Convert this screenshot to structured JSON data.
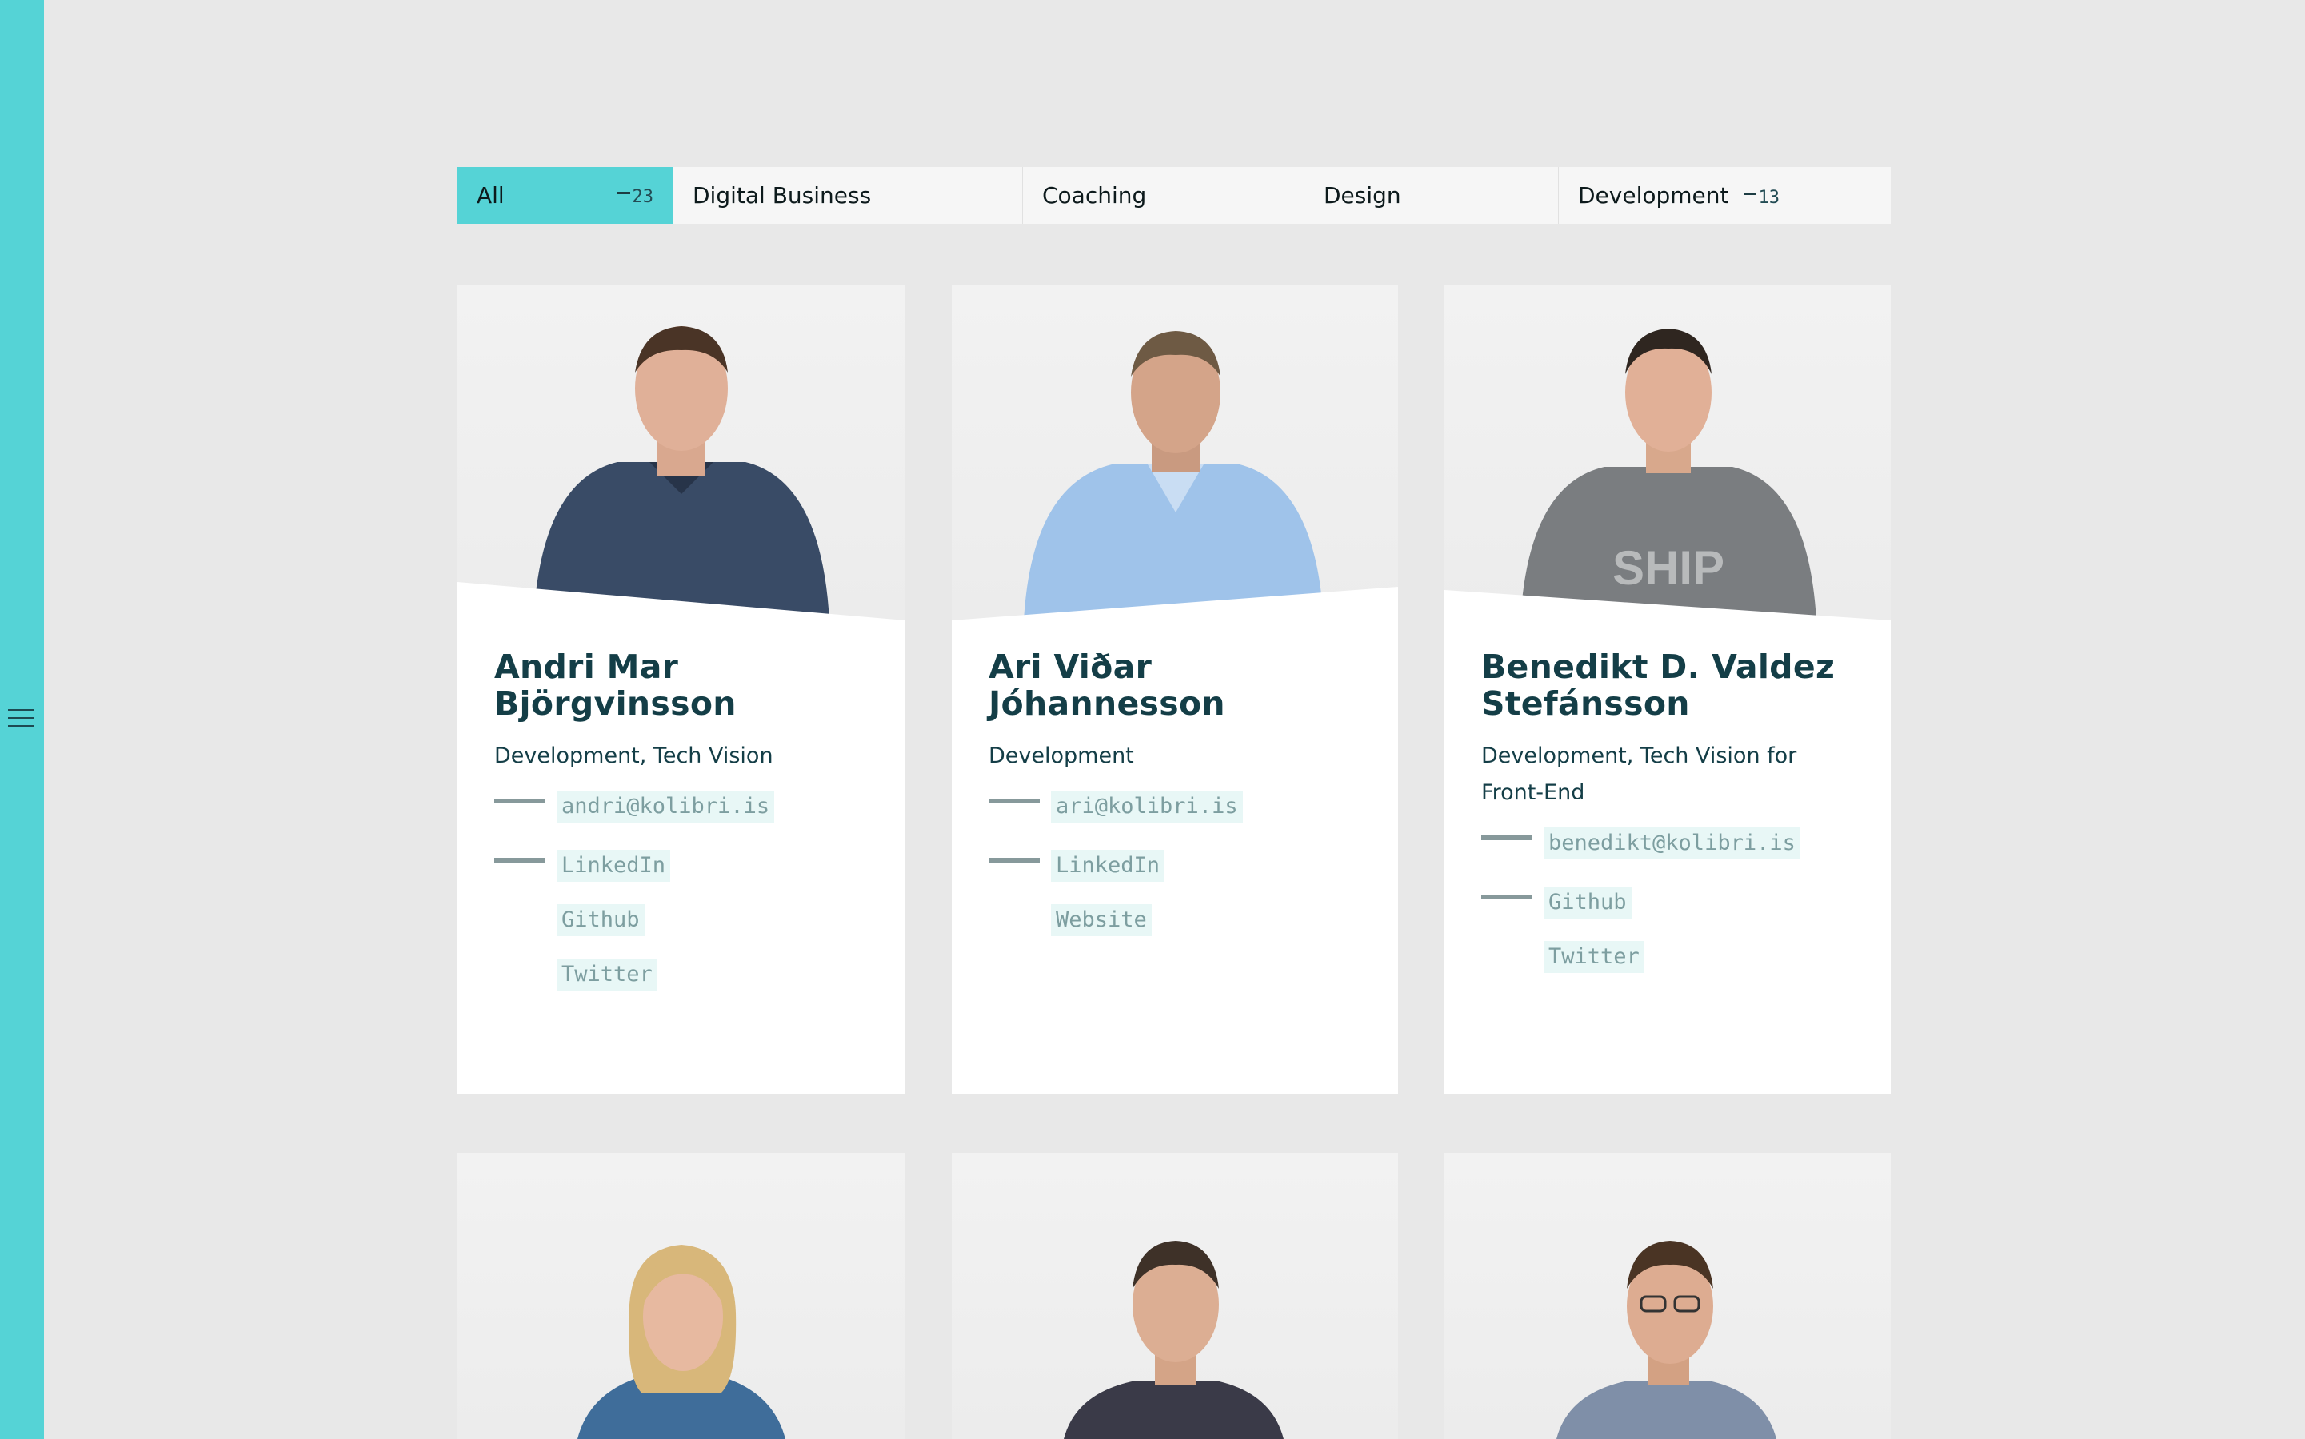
{
  "filters": [
    {
      "label": "All",
      "count": "23",
      "active": true
    },
    {
      "label": "Digital Business"
    },
    {
      "label": "Coaching"
    },
    {
      "label": "Design"
    },
    {
      "label": "Development",
      "count": "13"
    }
  ],
  "people": [
    {
      "name": "Andri Mar Björgvinsson",
      "role": "Development, Tech Vision",
      "email": "andri@kolibri.is",
      "links": [
        "LinkedIn",
        "Github",
        "Twitter"
      ]
    },
    {
      "name": "Ari Viðar Jóhannesson",
      "role": "Development",
      "email": "ari@kolibri.is",
      "links": [
        "LinkedIn",
        "Website"
      ]
    },
    {
      "name": "Benedikt D. Valdez Stefánsson",
      "role": "Development, Tech Vision for Front-End",
      "email": "benedikt@kolibri.is",
      "links": [
        "Github",
        "Twitter"
      ]
    }
  ],
  "colors": {
    "accent": "#55d3d6",
    "text": "#143e47",
    "background": "#e8e8e8"
  }
}
